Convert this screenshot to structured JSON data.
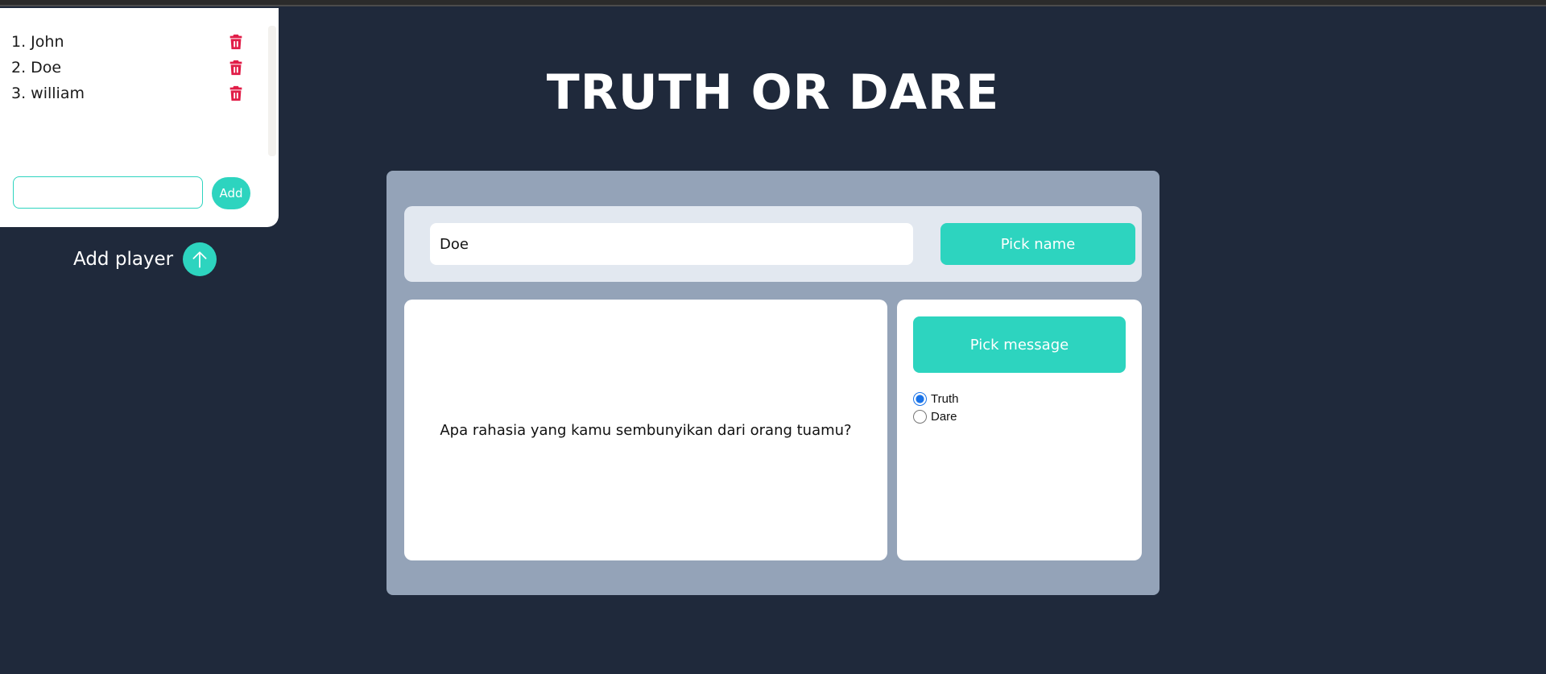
{
  "players": [
    {
      "label": "1. John"
    },
    {
      "label": "2. Doe"
    },
    {
      "label": "3. william"
    }
  ],
  "player_input": {
    "value": "",
    "placeholder": ""
  },
  "add_button_label": "Add",
  "add_player_label": "Add player",
  "title": "TRUTH OR DARE",
  "name_display": "Doe",
  "pick_name_label": "Pick name",
  "message": "Apa rahasia yang kamu sembunyikan dari orang tuamu?",
  "pick_message_label": "Pick message",
  "mode_options": [
    {
      "label": "Truth",
      "selected": true
    },
    {
      "label": "Dare",
      "selected": false
    }
  ],
  "colors": {
    "background": "#1f293b",
    "accent": "#2dd4bf",
    "card": "#94a3b8",
    "delete": "#e11d48"
  },
  "icons": {
    "delete": "trash-icon",
    "toggle": "arrow-up-icon"
  }
}
